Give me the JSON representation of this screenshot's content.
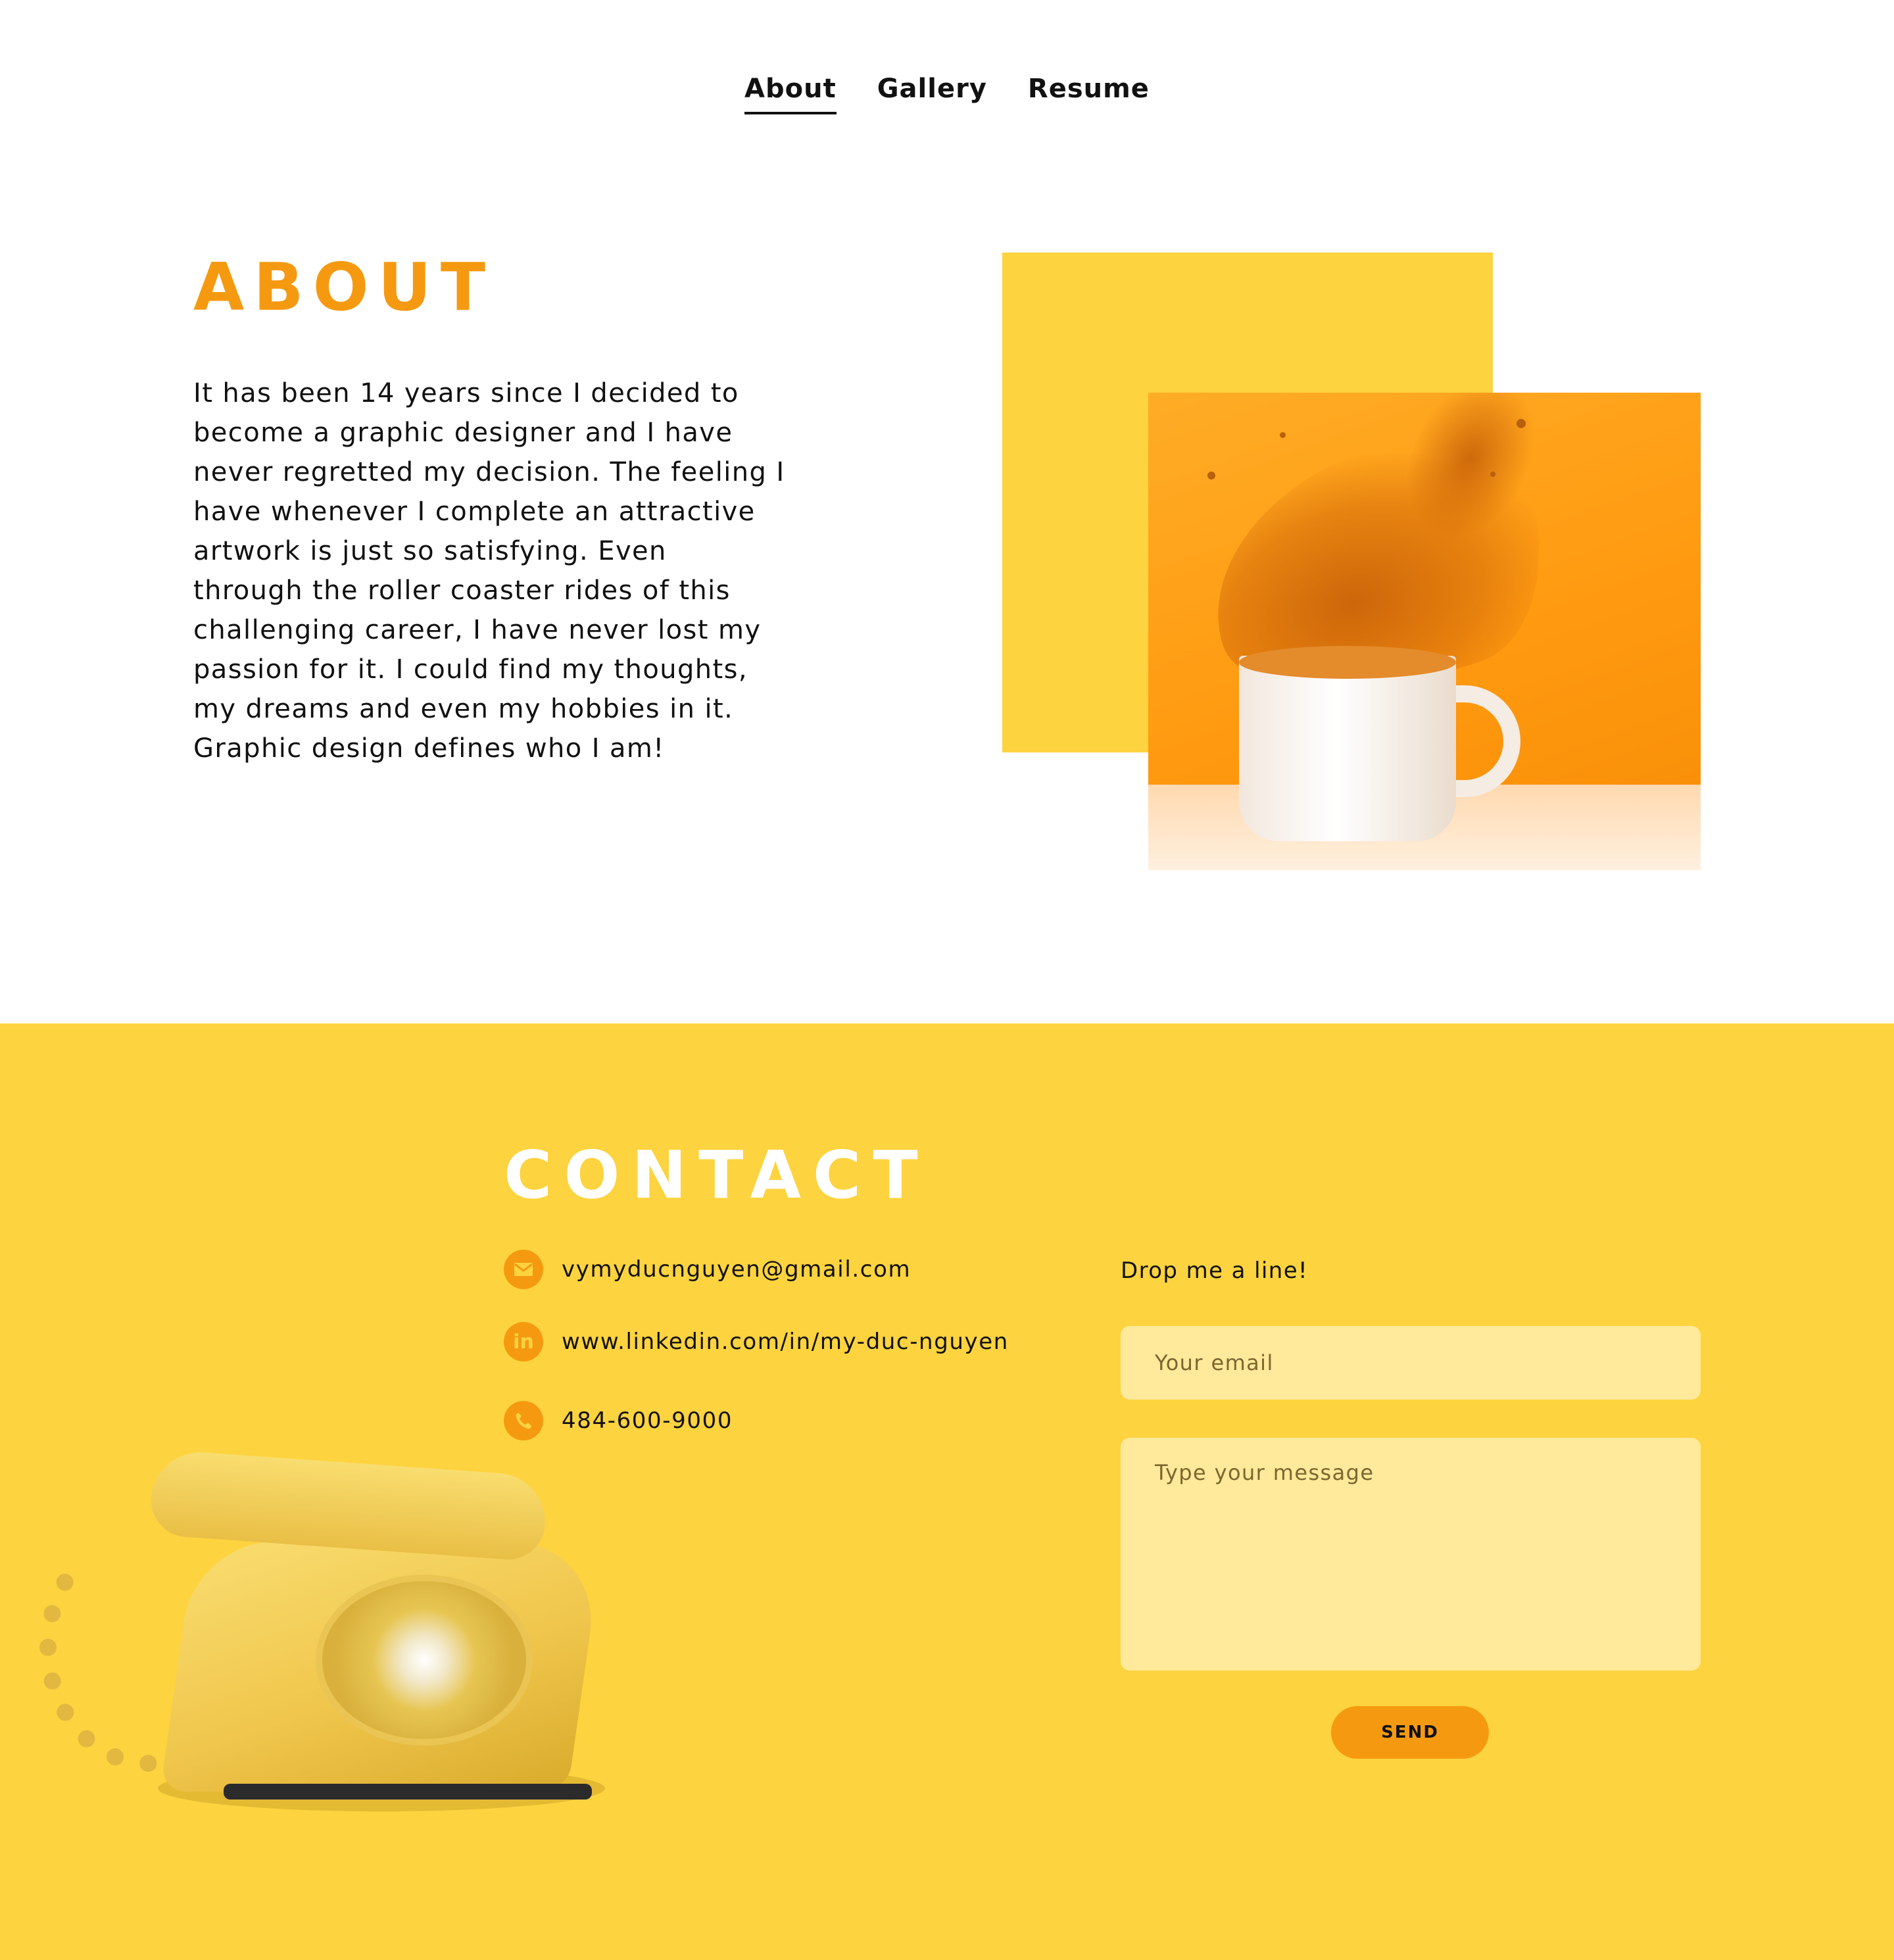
{
  "nav": {
    "items": [
      {
        "label": "About",
        "active": true
      },
      {
        "label": "Gallery",
        "active": false
      },
      {
        "label": "Resume",
        "active": false
      }
    ]
  },
  "about": {
    "title": "ABOUT",
    "text": "It has been 14 years since I decided to become a graphic designer and I have never regretted my decision. The feeling I have whenever I complete an attractive artwork is just so satisfying. Even through the roller coaster rides of this challenging career, I have never lost my passion for it. I could find my thoughts, my dreams and even my hobbies in it. Graphic design defines who I am!"
  },
  "contact": {
    "title": "CONTACT",
    "email": {
      "icon": "mail-icon",
      "text": "vymyducnguyen@gmail.com"
    },
    "linkedin": {
      "icon": "linkedin-icon",
      "text": "www.linkedin.com/in/my-duc-nguyen"
    },
    "phone": {
      "icon": "phone-icon",
      "text": "484-600-9000"
    },
    "form": {
      "intro": "Drop me a line!",
      "email_placeholder": "Your email",
      "message_placeholder": "Type your message",
      "send_label": "SEND"
    }
  },
  "colors": {
    "accent_orange": "#f59a10",
    "contact_yellow": "#fdd33f",
    "field_yellow": "#ffe99a"
  }
}
